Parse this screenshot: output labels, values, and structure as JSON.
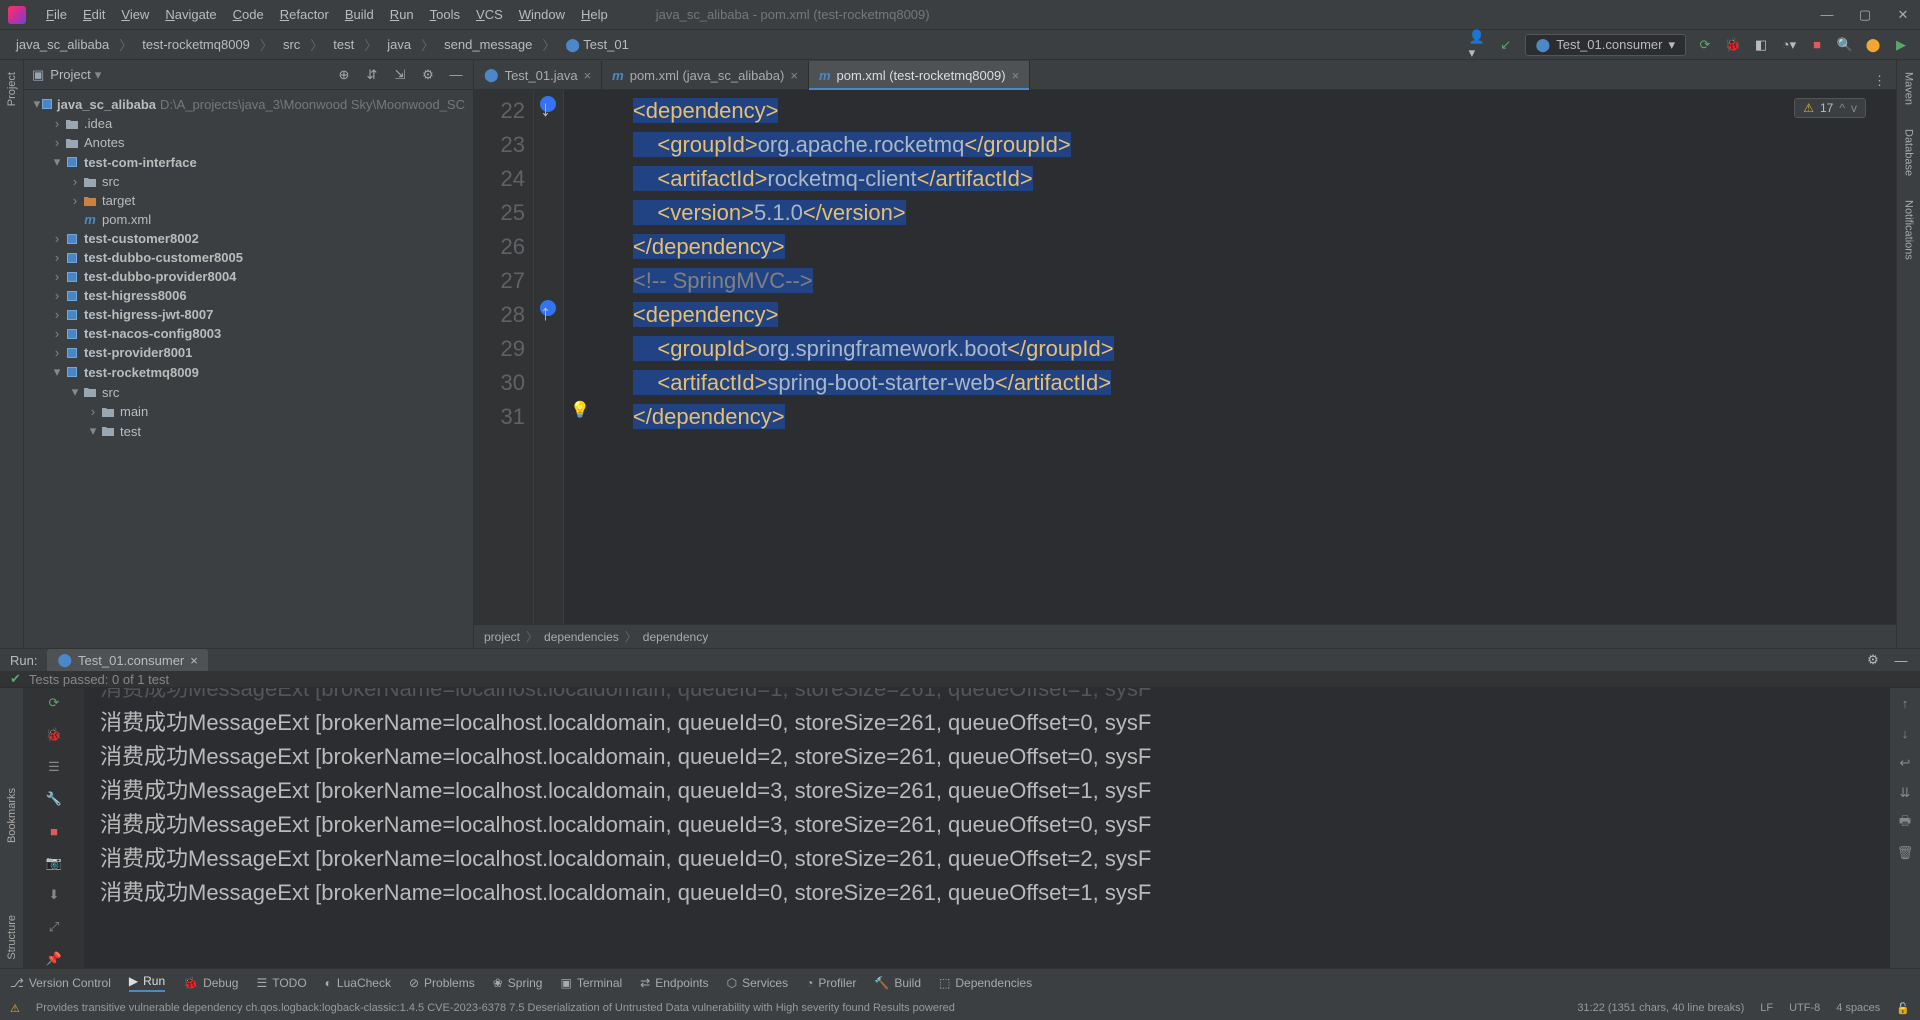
{
  "titlebar": {
    "menus": [
      "File",
      "Edit",
      "View",
      "Navigate",
      "Code",
      "Refactor",
      "Build",
      "Run",
      "Tools",
      "VCS",
      "Window",
      "Help"
    ],
    "title": "java_sc_alibaba - pom.xml (test-rocketmq8009)"
  },
  "breadcrumbs": [
    "java_sc_alibaba",
    "test-rocketmq8009",
    "src",
    "test",
    "java",
    "send_message",
    "Test_01"
  ],
  "run_config": "Test_01.consumer",
  "project_panel": {
    "title": "Project",
    "root": {
      "label": "java_sc_alibaba",
      "path": "D:\\A_projects\\java_3\\Moonwood Sky\\Moonwood_SC"
    },
    "items": [
      {
        "indent": 1,
        "arrow": ">",
        "icon": "folder",
        "label": ".idea"
      },
      {
        "indent": 1,
        "arrow": ">",
        "icon": "folder",
        "label": "Anotes"
      },
      {
        "indent": 1,
        "arrow": "v",
        "icon": "module",
        "label": "test-com-interface",
        "bold": true
      },
      {
        "indent": 2,
        "arrow": ">",
        "icon": "folder",
        "label": "src"
      },
      {
        "indent": 2,
        "arrow": ">",
        "icon": "folder-open",
        "label": "target"
      },
      {
        "indent": 2,
        "arrow": "",
        "icon": "maven",
        "label": "pom.xml"
      },
      {
        "indent": 1,
        "arrow": ">",
        "icon": "module",
        "label": "test-customer8002",
        "bold": true
      },
      {
        "indent": 1,
        "arrow": ">",
        "icon": "module",
        "label": "test-dubbo-customer8005",
        "bold": true
      },
      {
        "indent": 1,
        "arrow": ">",
        "icon": "module",
        "label": "test-dubbo-provider8004",
        "bold": true
      },
      {
        "indent": 1,
        "arrow": ">",
        "icon": "module",
        "label": "test-higress8006",
        "bold": true
      },
      {
        "indent": 1,
        "arrow": ">",
        "icon": "module",
        "label": "test-higress-jwt-8007",
        "bold": true
      },
      {
        "indent": 1,
        "arrow": ">",
        "icon": "module",
        "label": "test-nacos-config8003",
        "bold": true
      },
      {
        "indent": 1,
        "arrow": ">",
        "icon": "module",
        "label": "test-provider8001",
        "bold": true
      },
      {
        "indent": 1,
        "arrow": "v",
        "icon": "module",
        "label": "test-rocketmq8009",
        "bold": true
      },
      {
        "indent": 2,
        "arrow": "v",
        "icon": "folder",
        "label": "src"
      },
      {
        "indent": 3,
        "arrow": ">",
        "icon": "folder",
        "label": "main"
      },
      {
        "indent": 3,
        "arrow": "v",
        "icon": "folder",
        "label": "test"
      }
    ]
  },
  "editor_tabs": [
    {
      "label": "Test_01.java",
      "icon": "class",
      "active": false
    },
    {
      "label": "pom.xml (java_sc_alibaba)",
      "icon": "maven",
      "active": false
    },
    {
      "label": "pom.xml (test-rocketmq8009)",
      "icon": "maven",
      "active": true
    }
  ],
  "editor": {
    "warning_count": "17",
    "line_numbers": [
      "22",
      "23",
      "24",
      "25",
      "26",
      "27",
      "28",
      "29",
      "30",
      "31"
    ],
    "lines": [
      {
        "sel": true,
        "segs": [
          [
            "<dependency>",
            "tag"
          ]
        ]
      },
      {
        "sel": true,
        "segs": [
          [
            "    <groupId>",
            "tag"
          ],
          [
            "org.apache.rocketmq",
            "val"
          ],
          [
            "</groupId>",
            "tag"
          ]
        ]
      },
      {
        "sel": true,
        "segs": [
          [
            "    <artifactId>",
            "tag"
          ],
          [
            "rocketmq-client",
            "val"
          ],
          [
            "</artifactId>",
            "tag"
          ]
        ]
      },
      {
        "sel": true,
        "segs": [
          [
            "    <version>",
            "tag"
          ],
          [
            "5.1.0",
            "val"
          ],
          [
            "</version>",
            "tag"
          ]
        ]
      },
      {
        "sel": true,
        "segs": [
          [
            "</dependency>",
            "tag"
          ]
        ]
      },
      {
        "sel": true,
        "segs": [
          [
            "<!-- SpringMVC-->",
            "comment"
          ]
        ]
      },
      {
        "sel": true,
        "segs": [
          [
            "<dependency>",
            "tag"
          ]
        ]
      },
      {
        "sel": true,
        "segs": [
          [
            "    <groupId>",
            "tag"
          ],
          [
            "org.springframework.boot",
            "val"
          ],
          [
            "</groupId>",
            "tag"
          ]
        ]
      },
      {
        "sel": true,
        "segs": [
          [
            "    <artifactId>",
            "tag"
          ],
          [
            "spring-boot-starter-web",
            "val"
          ],
          [
            "</artifactId>",
            "tag"
          ]
        ]
      },
      {
        "sel": true,
        "segs": [
          [
            "</dependency>",
            "tag"
          ]
        ]
      }
    ],
    "crumbs": [
      "project",
      "dependencies",
      "dependency"
    ]
  },
  "run": {
    "label": "Run:",
    "tab": "Test_01.consumer",
    "tests_passed": "Tests passed: 0",
    "tests_total": " of 1 test",
    "lines": [
      "消费成功MessageExt [brokerName=localhost.localdomain, queueId=0, storeSize=261, queueOffset=0, sysF",
      "消费成功MessageExt [brokerName=localhost.localdomain, queueId=2, storeSize=261, queueOffset=0, sysF",
      "消费成功MessageExt [brokerName=localhost.localdomain, queueId=3, storeSize=261, queueOffset=1, sysF",
      "消费成功MessageExt [brokerName=localhost.localdomain, queueId=3, storeSize=261, queueOffset=0, sysF",
      "消费成功MessageExt [brokerName=localhost.localdomain, queueId=0, storeSize=261, queueOffset=2, sysF",
      "消费成功MessageExt [brokerName=localhost.localdomain, queueId=0, storeSize=261, queueOffset=1, sysF"
    ]
  },
  "bottom_tools": [
    "Version Control",
    "Run",
    "Debug",
    "TODO",
    "LuaCheck",
    "Problems",
    "Spring",
    "Terminal",
    "Endpoints",
    "Services",
    "Profiler",
    "Build",
    "Dependencies"
  ],
  "status": {
    "msg": "Provides transitive vulnerable dependency ch.qos.logback:logback-classic:1.4.5 CVE-2023-6378 7.5 Deserialization of Untrusted Data vulnerability with High severity found  Results powered",
    "pos": "31:22 (1351 chars, 40 line breaks)",
    "enc": "LF",
    "charset": "UTF-8",
    "indent": "4 spaces"
  },
  "left_rail_labels": [
    "Project"
  ],
  "left_rail2_labels": [
    "Bookmarks",
    "Structure"
  ],
  "right_rail_labels": [
    "Maven",
    "Database",
    "Notifications"
  ]
}
